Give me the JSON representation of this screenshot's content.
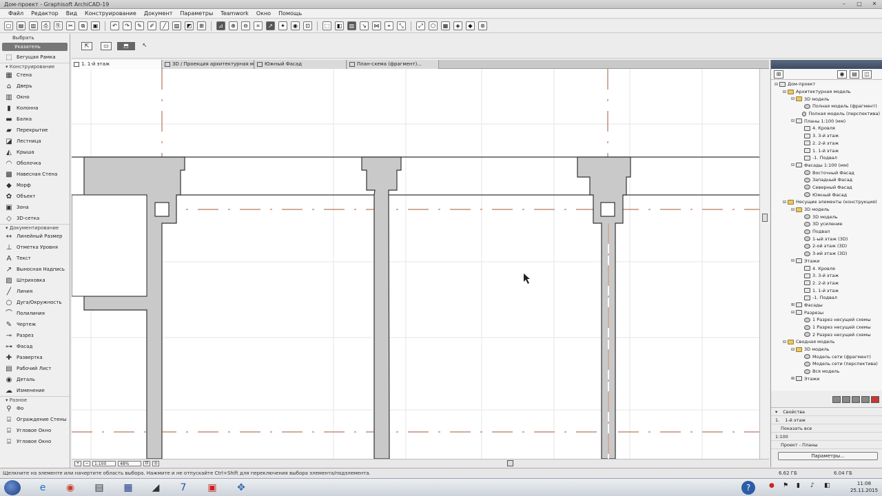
{
  "window": {
    "title": "Дом-проект - Graphisoft ArchiCAD-19"
  },
  "menu": [
    "Файл",
    "Редактор",
    "Вид",
    "Конструирование",
    "Документ",
    "Параметры",
    "Teamwork",
    "Окно",
    "Помощь"
  ],
  "toolbox": {
    "header": "Выбрать",
    "selected": "Указатель",
    "marquee": "Бегущая Рамка",
    "groups": [
      {
        "label": "Конструирование",
        "tools": [
          {
            "icon": "wall-icon",
            "glyph": "▦",
            "label": "Стена"
          },
          {
            "icon": "door-icon",
            "glyph": "⌂",
            "label": "Дверь"
          },
          {
            "icon": "window-icon",
            "glyph": "▥",
            "label": "Окно"
          },
          {
            "icon": "column-icon",
            "glyph": "▮",
            "label": "Колонна"
          },
          {
            "icon": "beam-icon",
            "glyph": "▬",
            "label": "Балка"
          },
          {
            "icon": "slab-icon",
            "glyph": "▰",
            "label": "Перекрытие"
          },
          {
            "icon": "stair-icon",
            "glyph": "◪",
            "label": "Лестница"
          },
          {
            "icon": "roof-icon",
            "glyph": "◭",
            "label": "Крыша"
          },
          {
            "icon": "shell-icon",
            "glyph": "◠",
            "label": "Оболочка"
          },
          {
            "icon": "curtain-wall-icon",
            "glyph": "▩",
            "label": "Навесная Стена"
          },
          {
            "icon": "morph-icon",
            "glyph": "◆",
            "label": "Морф"
          },
          {
            "icon": "object-icon",
            "glyph": "✿",
            "label": "Объект"
          },
          {
            "icon": "zone-icon",
            "glyph": "▣",
            "label": "Зона"
          },
          {
            "icon": "mesh-icon",
            "glyph": "◇",
            "label": "3D-сетка"
          }
        ]
      },
      {
        "label": "Документирование",
        "tools": [
          {
            "icon": "dimension-icon",
            "glyph": "↔",
            "label": "Линейный Размер"
          },
          {
            "icon": "level-dimension-icon",
            "glyph": "⊥",
            "label": "Отметка Уровня"
          },
          {
            "icon": "text-icon",
            "glyph": "A",
            "label": "Текст"
          },
          {
            "icon": "label-icon",
            "glyph": "↗",
            "label": "Выносная Надпись"
          },
          {
            "icon": "fill-icon",
            "glyph": "▨",
            "label": "Штриховка"
          },
          {
            "icon": "line-icon",
            "glyph": "╱",
            "label": "Линия"
          },
          {
            "icon": "arc-icon",
            "glyph": "○",
            "label": "Дуга/Окружность"
          },
          {
            "icon": "polyline-icon",
            "glyph": "⌒",
            "label": "Полилиния"
          },
          {
            "icon": "drawing-icon",
            "glyph": "✎",
            "label": "Чертеж"
          },
          {
            "icon": "section-icon",
            "glyph": "⊸",
            "label": "Разрез"
          },
          {
            "icon": "elevation-icon",
            "glyph": "⊶",
            "label": "Фасад"
          },
          {
            "icon": "interior-elevation-icon",
            "glyph": "✚",
            "label": "Развертка"
          },
          {
            "icon": "worksheet-icon",
            "glyph": "▤",
            "label": "Рабочий Лист"
          },
          {
            "icon": "detail-icon",
            "glyph": "◉",
            "label": "Деталь"
          },
          {
            "icon": "change-icon",
            "glyph": "☁",
            "label": "Изменение"
          }
        ]
      },
      {
        "label": "Разное",
        "tools": [
          {
            "icon": "camera-icon",
            "glyph": "⚲",
            "label": "Фо"
          },
          {
            "icon": "railing-icon",
            "glyph": "⌸",
            "label": "Ограждение Стены"
          },
          {
            "icon": "curtain-icon",
            "glyph": "⌸",
            "label": "Угловое Окно"
          },
          {
            "icon": "skylight-icon",
            "glyph": "⌸",
            "label": "Угловое Окно"
          }
        ]
      }
    ]
  },
  "tabs": [
    {
      "label": "1. 1-й этаж",
      "active": true
    },
    {
      "label": "3D / Проекция архитектурная модель...",
      "active": false
    },
    {
      "label": "Южный Фасад",
      "active": false
    },
    {
      "label": "План-схема (фрагмент)...",
      "active": false
    }
  ],
  "navigator": {
    "tree": [
      {
        "d": 0,
        "t": "−",
        "k": "file",
        "l": "Дом-проект"
      },
      {
        "d": 1,
        "t": "−",
        "k": "folder",
        "l": "Архитектурная модель"
      },
      {
        "d": 2,
        "t": "−",
        "k": "folder",
        "l": "3D модель"
      },
      {
        "d": 3,
        "t": "",
        "k": "view",
        "l": "Полная модель (фрагмент)"
      },
      {
        "d": 3,
        "t": "",
        "k": "view",
        "l": "Полная модель (перспектива)"
      },
      {
        "d": 2,
        "t": "−",
        "k": "file",
        "l": "Планы 1:100 (мм)"
      },
      {
        "d": 3,
        "t": "",
        "k": "file",
        "l": "4. Кровля"
      },
      {
        "d": 3,
        "t": "",
        "k": "file",
        "l": "3. 3-й этаж"
      },
      {
        "d": 3,
        "t": "",
        "k": "file",
        "l": "2. 2-й этаж"
      },
      {
        "d": 3,
        "t": "",
        "k": "file",
        "l": "1. 1-й этаж"
      },
      {
        "d": 3,
        "t": "",
        "k": "file",
        "l": "-1. Подвал"
      },
      {
        "d": 2,
        "t": "−",
        "k": "file",
        "l": "Фасады 1:100 (мм)"
      },
      {
        "d": 3,
        "t": "",
        "k": "view",
        "l": "Восточный Фасад"
      },
      {
        "d": 3,
        "t": "",
        "k": "view",
        "l": "Западный Фасад"
      },
      {
        "d": 3,
        "t": "",
        "k": "view",
        "l": "Северный Фасад"
      },
      {
        "d": 3,
        "t": "",
        "k": "view",
        "l": "Южный Фасад"
      },
      {
        "d": 1,
        "t": "−",
        "k": "folder",
        "l": "Несущие элементы (конструкция)"
      },
      {
        "d": 2,
        "t": "−",
        "k": "folder",
        "l": "3D модель"
      },
      {
        "d": 3,
        "t": "",
        "k": "view",
        "l": "3D модель"
      },
      {
        "d": 3,
        "t": "",
        "k": "view",
        "l": "3D усиление"
      },
      {
        "d": 3,
        "t": "",
        "k": "view",
        "l": "Подвал"
      },
      {
        "d": 3,
        "t": "",
        "k": "view",
        "l": "1-ый этаж (3D)"
      },
      {
        "d": 3,
        "t": "",
        "k": "view",
        "l": "2-ой этаж (3D)"
      },
      {
        "d": 3,
        "t": "",
        "k": "view",
        "l": "3-ий этаж (3D)"
      },
      {
        "d": 2,
        "t": "−",
        "k": "file",
        "l": "Этажи"
      },
      {
        "d": 3,
        "t": "",
        "k": "file",
        "l": "4. Кровля"
      },
      {
        "d": 3,
        "t": "",
        "k": "file",
        "l": "3. 3-й этаж"
      },
      {
        "d": 3,
        "t": "",
        "k": "file",
        "l": "2. 2-й этаж"
      },
      {
        "d": 3,
        "t": "",
        "k": "file",
        "l": "1. 1-й этаж"
      },
      {
        "d": 3,
        "t": "",
        "k": "file",
        "l": "-1. Подвал"
      },
      {
        "d": 2,
        "t": "+",
        "k": "file",
        "l": "Фасады"
      },
      {
        "d": 2,
        "t": "−",
        "k": "file",
        "l": "Разрезы"
      },
      {
        "d": 3,
        "t": "",
        "k": "view",
        "l": "1 Разрез несущей схемы"
      },
      {
        "d": 3,
        "t": "",
        "k": "view",
        "l": "1 Разрез несущей схемы"
      },
      {
        "d": 3,
        "t": "",
        "k": "view",
        "l": "2 Разрез несущей схемы"
      },
      {
        "d": 1,
        "t": "−",
        "k": "folder",
        "l": "Сводная модель"
      },
      {
        "d": 2,
        "t": "−",
        "k": "folder",
        "l": "3D модель"
      },
      {
        "d": 3,
        "t": "",
        "k": "view",
        "l": "Модель сети (фрагмент)"
      },
      {
        "d": 3,
        "t": "",
        "k": "view",
        "l": "Модель сети (перспектива)"
      },
      {
        "d": 3,
        "t": "",
        "k": "view",
        "l": "Вся модель"
      },
      {
        "d": 2,
        "t": "+",
        "k": "file",
        "l": "Этажи"
      }
    ],
    "properties_title": "Свойства",
    "properties": [
      {
        "key": "1.",
        "value": "1-й этаж"
      },
      {
        "key": "",
        "value": "Показать все"
      },
      {
        "key": "1:100",
        "value": ""
      },
      {
        "key": "",
        "value": "Проект - Планы"
      }
    ],
    "settings_button": "Параметры..."
  },
  "zoom": {
    "scale": "1:100",
    "percent": "48%"
  },
  "status": {
    "message": "Щелкните на элементе или начертите область выбора. Нажмите и не отпускайте Ctrl+Shift для переключения выбора элемента/подэлемента.",
    "disk1": "6.62 ГБ",
    "disk2": "6.04 ГБ"
  },
  "taskbar": {
    "time": "11:08",
    "date": "25.11.2015"
  }
}
